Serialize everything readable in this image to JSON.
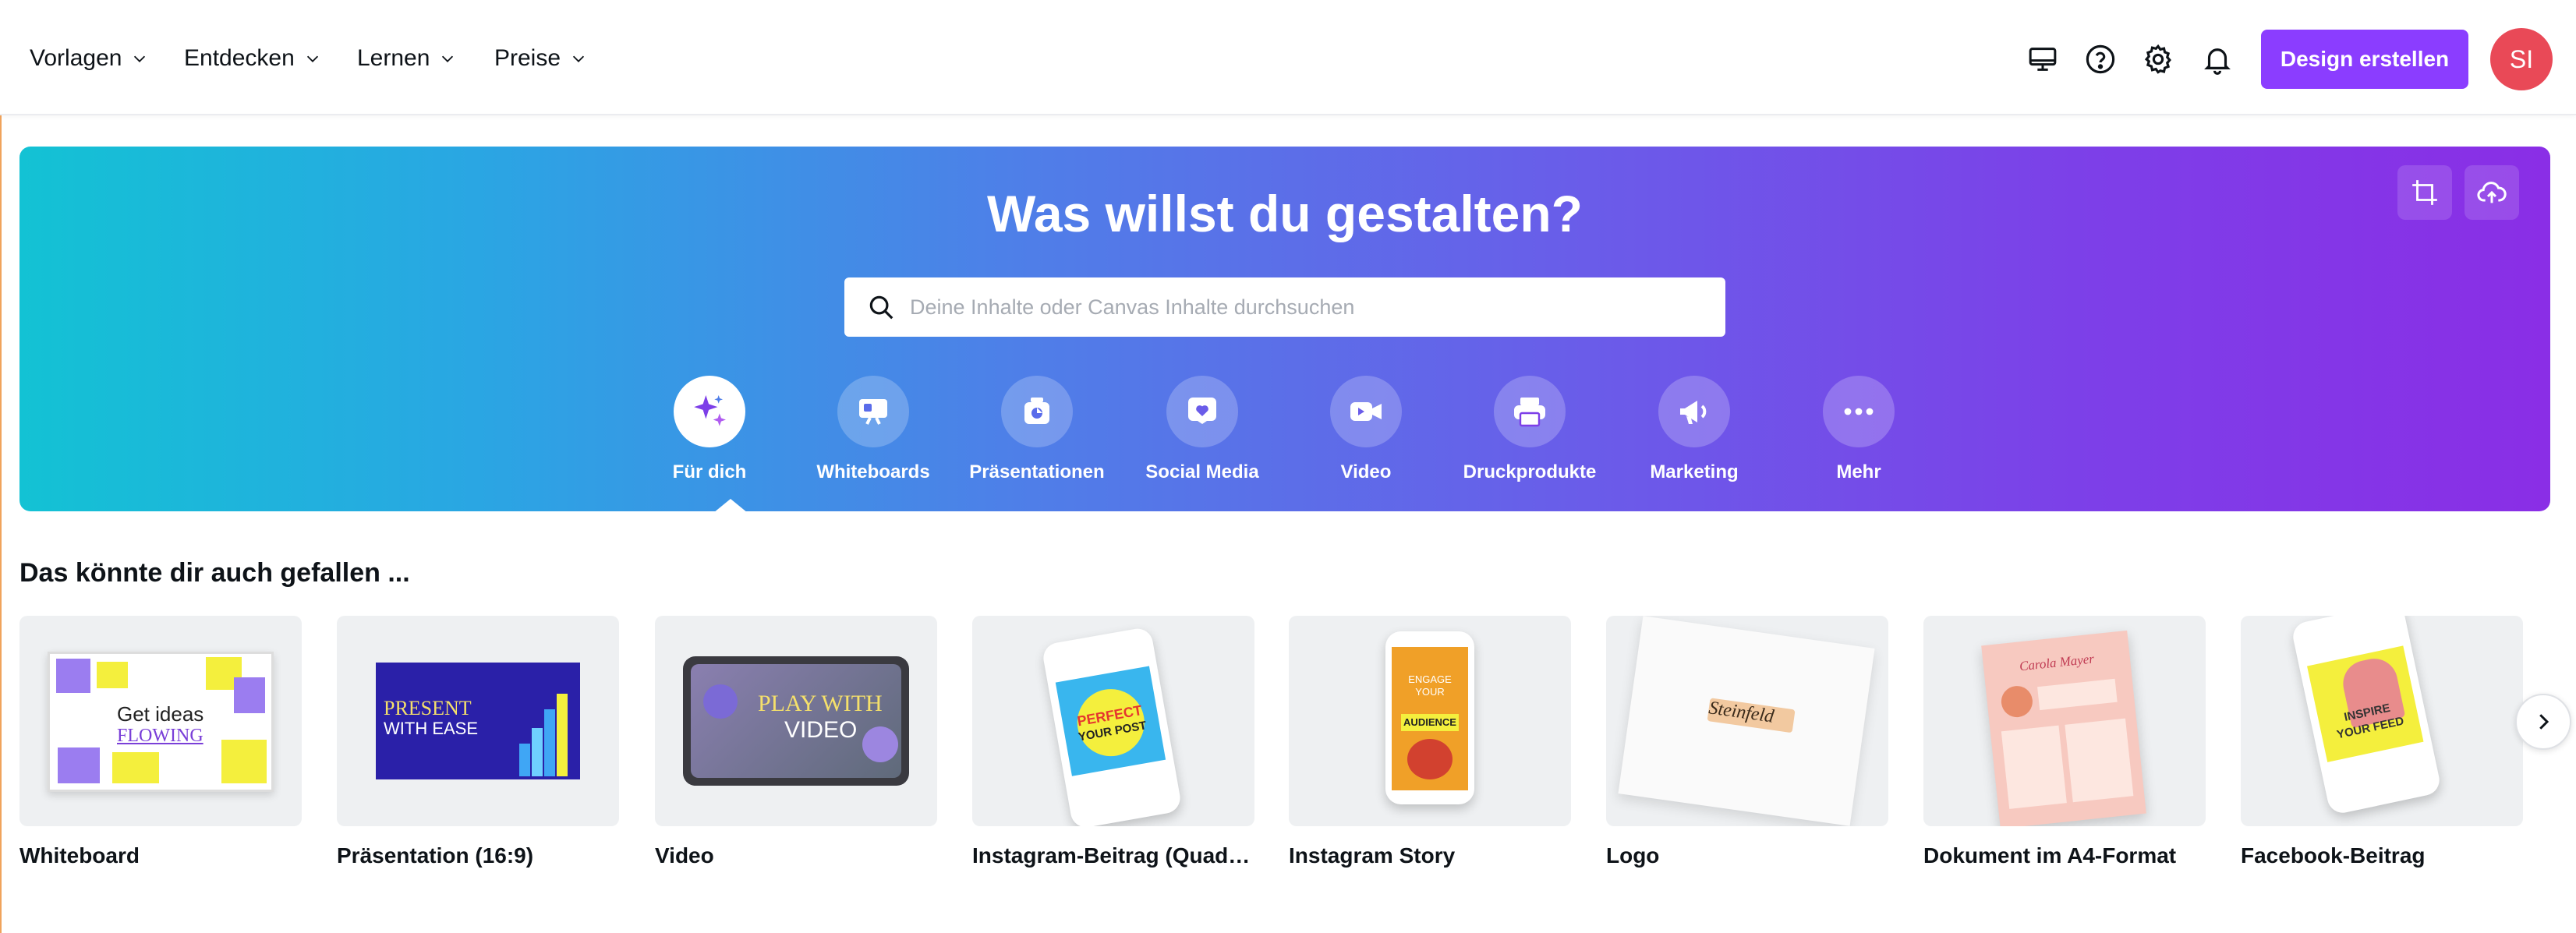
{
  "nav": {
    "items": [
      {
        "label": "Vorlagen"
      },
      {
        "label": "Entdecken"
      },
      {
        "label": "Lernen"
      },
      {
        "label": "Preise"
      }
    ],
    "cta_label": "Design erstellen",
    "avatar_initials": "SI",
    "icons": [
      "monitor-icon",
      "help-icon",
      "gear-icon",
      "bell-icon"
    ]
  },
  "hero": {
    "title": "Was willst du gestalten?",
    "search_placeholder": "Deine Inhalte oder Canvas Inhalte durchsuchen",
    "tools": [
      "crop-icon",
      "cloud-upload-icon"
    ],
    "categories": [
      {
        "label": "Für dich",
        "icon": "sparkle-icon",
        "active": true
      },
      {
        "label": "Whiteboards",
        "icon": "whiteboard-icon"
      },
      {
        "label": "Präsentationen",
        "icon": "presentation-icon"
      },
      {
        "label": "Social Media",
        "icon": "heart-icon"
      },
      {
        "label": "Video",
        "icon": "video-icon"
      },
      {
        "label": "Druckprodukte",
        "icon": "printer-icon"
      },
      {
        "label": "Marketing",
        "icon": "megaphone-icon"
      },
      {
        "label": "Mehr",
        "icon": "more-icon"
      }
    ]
  },
  "suggestions": {
    "title": "Das könnte dir auch gefallen ...",
    "cards": [
      {
        "label": "Whiteboard",
        "thumb_text": [
          "Get ideas",
          "FLOWING"
        ]
      },
      {
        "label": "Präsentation (16:9)",
        "thumb_text": [
          "PRESENT",
          "WITH EASE"
        ]
      },
      {
        "label": "Video",
        "thumb_text": [
          "PLAY WITH",
          "VIDEO"
        ]
      },
      {
        "label": "Instagram-Beitrag (Quadrat)",
        "thumb_text": [
          "PERFECT",
          "YOUR POST"
        ]
      },
      {
        "label": "Instagram Story",
        "thumb_text": [
          "ENGAGE",
          "YOUR",
          "AUDIENCE"
        ]
      },
      {
        "label": "Logo",
        "thumb_text": [
          "Steinfeld"
        ]
      },
      {
        "label": "Dokument im A4-Format",
        "thumb_text": [
          "Carola Mayer"
        ]
      },
      {
        "label": "Facebook-Beitrag",
        "thumb_text": [
          "INSPIRE",
          "YOUR FEED"
        ]
      }
    ]
  },
  "colors": {
    "brand": "#8b3dff",
    "avatar": "#e94957",
    "hero_gradient": [
      "#13c2d4",
      "#8a2ee6"
    ]
  }
}
